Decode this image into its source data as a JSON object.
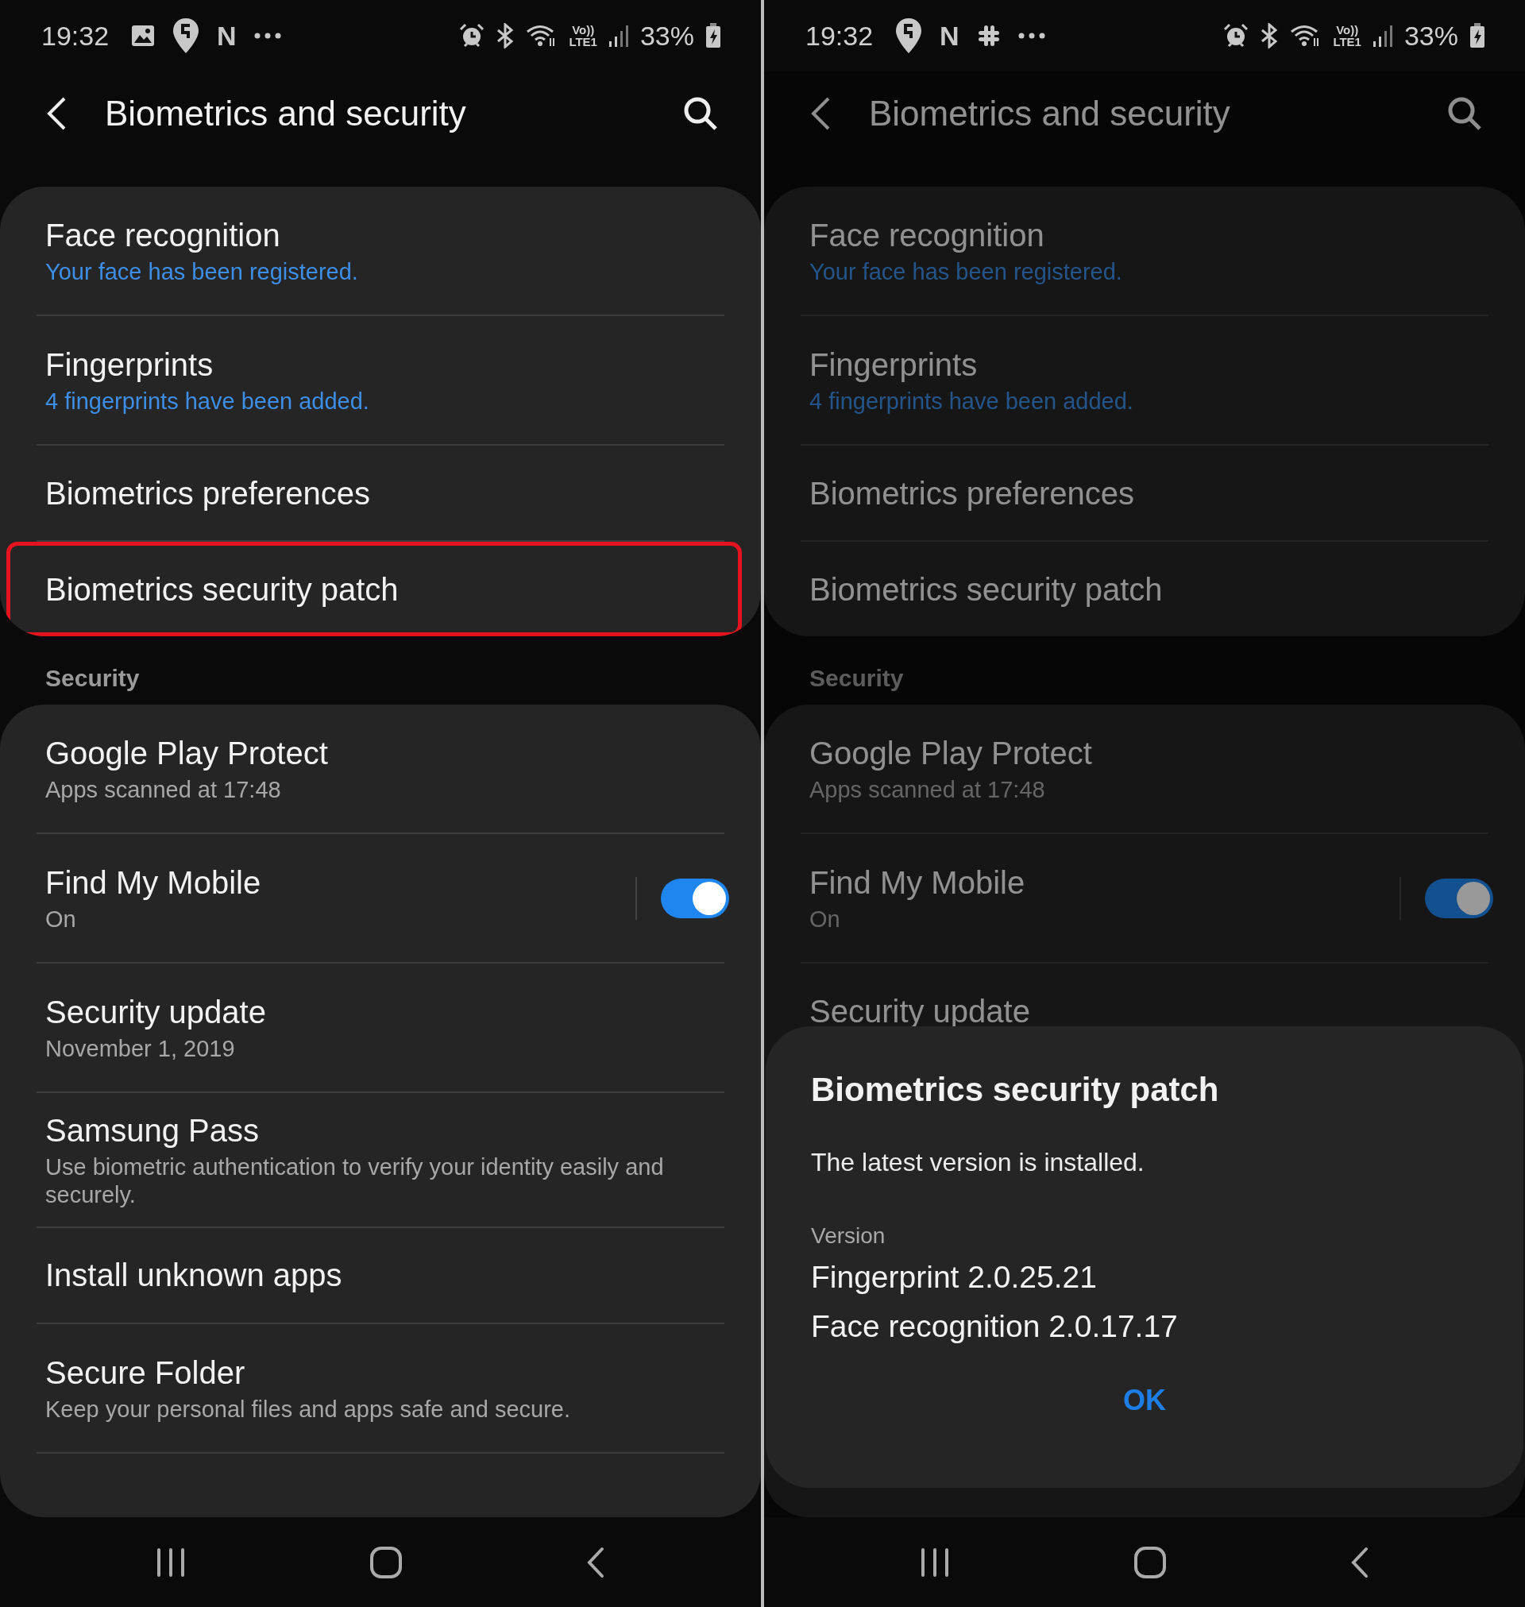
{
  "panels": [
    {
      "dimmed": false,
      "status_bar": {
        "time": "19:32",
        "notifications": [
          {
            "kind": "gallery"
          },
          {
            "kind": "pin"
          },
          {
            "kind": "letter",
            "text": "N"
          },
          {
            "kind": "more"
          }
        ],
        "volte": "Vo))",
        "lte": "LTE1",
        "battery": "33%"
      },
      "header": {
        "title": "Biometrics and security"
      },
      "groups": [
        {
          "items": [
            {
              "title": "Face recognition",
              "subtitle": "Your face has been registered.",
              "accent": true,
              "highlighted": false
            },
            {
              "title": "Fingerprints",
              "subtitle": "4 fingerprints have been added.",
              "accent": true,
              "highlighted": false
            },
            {
              "title": "Biometrics preferences",
              "highlighted": false
            },
            {
              "title": "Biometrics security patch",
              "highlighted": true
            }
          ]
        },
        {
          "heading": "Security",
          "items": [
            {
              "title": "Google Play Protect",
              "subtitle": "Apps scanned at 17:48",
              "accent": false,
              "highlighted": false
            },
            {
              "title": "Find My Mobile",
              "subtitle": "On",
              "accent": false,
              "highlighted": false,
              "toggle": {
                "on": true
              }
            },
            {
              "title": "Security update",
              "subtitle": "November 1, 2019",
              "accent": false,
              "highlighted": false
            },
            {
              "title": "Samsung Pass",
              "subtitle": "Use biometric authentication to verify your identity easily and securely.",
              "accent": false,
              "highlighted": false
            },
            {
              "title": "Install unknown apps",
              "highlighted": false
            },
            {
              "title": "Secure Folder",
              "subtitle": "Keep your personal files and apps safe and secure.",
              "accent": false,
              "highlighted": false
            }
          ]
        }
      ]
    },
    {
      "dimmed": true,
      "status_bar": {
        "time": "19:32",
        "notifications": [
          {
            "kind": "pin"
          },
          {
            "kind": "letter",
            "text": "N"
          },
          {
            "kind": "hash"
          },
          {
            "kind": "more"
          }
        ],
        "volte": "Vo))",
        "lte": "LTE1",
        "battery": "33%"
      },
      "header": {
        "title": "Biometrics and security"
      },
      "groups": [
        {
          "items": [
            {
              "title": "Face recognition",
              "subtitle": "Your face has been registered.",
              "accent": true,
              "highlighted": false
            },
            {
              "title": "Fingerprints",
              "subtitle": "4 fingerprints have been added.",
              "accent": true,
              "highlighted": false
            },
            {
              "title": "Biometrics preferences",
              "highlighted": false
            },
            {
              "title": "Biometrics security patch",
              "highlighted": false
            }
          ]
        },
        {
          "heading": "Security",
          "items": [
            {
              "title": "Google Play Protect",
              "subtitle": "Apps scanned at 17:48",
              "accent": false,
              "highlighted": false
            },
            {
              "title": "Find My Mobile",
              "subtitle": "On",
              "accent": false,
              "highlighted": false,
              "toggle": {
                "on": true
              }
            },
            {
              "title": "Security update",
              "highlighted": false
            }
          ]
        }
      ],
      "dialog": {
        "title": "Biometrics security patch",
        "message": "The latest version is installed.",
        "label": "Version",
        "lines": [
          "Fingerprint 2.0.25.21",
          "Face recognition 2.0.17.17"
        ],
        "button": "OK"
      }
    }
  ]
}
